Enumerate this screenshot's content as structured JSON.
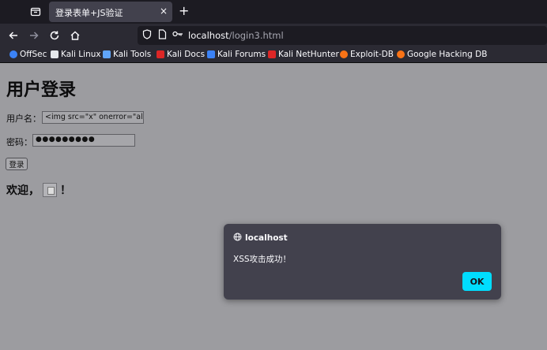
{
  "browser": {
    "tab_title": "登录表单+JS验证",
    "tab_close": "×",
    "new_tab": "+",
    "url_host": "localhost",
    "url_path": "/login3.html"
  },
  "bookmarks": [
    {
      "label": "OffSec",
      "color": "#3b82f6"
    },
    {
      "label": "Kali Linux",
      "color": "#e5e7eb"
    },
    {
      "label": "Kali Tools",
      "color": "#60a5fa"
    },
    {
      "label": "Kali Docs",
      "color": "#dc2626"
    },
    {
      "label": "Kali Forums",
      "color": "#3b82f6"
    },
    {
      "label": "Kali NetHunter",
      "color": "#dc2626"
    },
    {
      "label": "Exploit-DB",
      "color": "#f97316"
    },
    {
      "label": "Google Hacking DB",
      "color": "#f97316"
    }
  ],
  "form": {
    "title": "用户登录",
    "username_label": "用户名：",
    "username_value": "<img src=\"x\" onerror=\"alert('",
    "password_label": "密码：",
    "password_value": "●●●●●●●●●",
    "submit_label": "登录",
    "welcome_prefix": "欢迎，",
    "welcome_suffix": "！"
  },
  "alert": {
    "origin": "localhost",
    "message": "XSS攻击成功！",
    "ok_label": "OK"
  },
  "colors": {
    "accent": "#00ddff",
    "page_bg": "#9c9ca0",
    "dialog_bg": "#42414d"
  }
}
